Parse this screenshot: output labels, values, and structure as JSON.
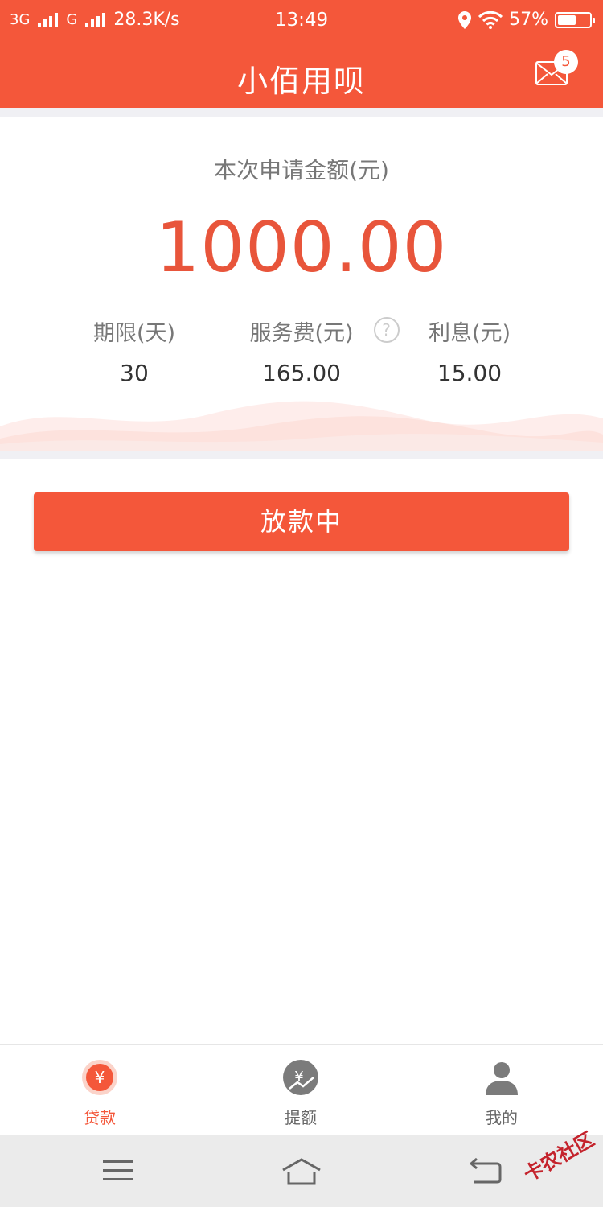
{
  "status_bar": {
    "network1": "3G",
    "network2": "G",
    "speed": "28.3K/s",
    "time": "13:49",
    "battery": "57%",
    "battery_level": 0.57
  },
  "header": {
    "title": "小佰用呗",
    "mail_badge": "5"
  },
  "loan": {
    "amount_label": "本次申请金额(元)",
    "amount": "1000.00",
    "term_label": "期限(天)",
    "term_value": "30",
    "fee_label": "服务费(元)",
    "fee_help": "?",
    "fee_value": "165.00",
    "interest_label": "利息(元)",
    "interest_value": "15.00"
  },
  "action": {
    "button_label": "放款中"
  },
  "tabs": [
    {
      "label": "贷款",
      "icon": "yen-coin-icon",
      "active": true
    },
    {
      "label": "提额",
      "icon": "yen-chart-icon",
      "active": false
    },
    {
      "label": "我的",
      "icon": "person-icon",
      "active": false
    }
  ],
  "watermark": "卡农社区",
  "colors": {
    "brand": "#f4573a",
    "amount": "#e8553b",
    "tab_inactive": "#666666"
  }
}
